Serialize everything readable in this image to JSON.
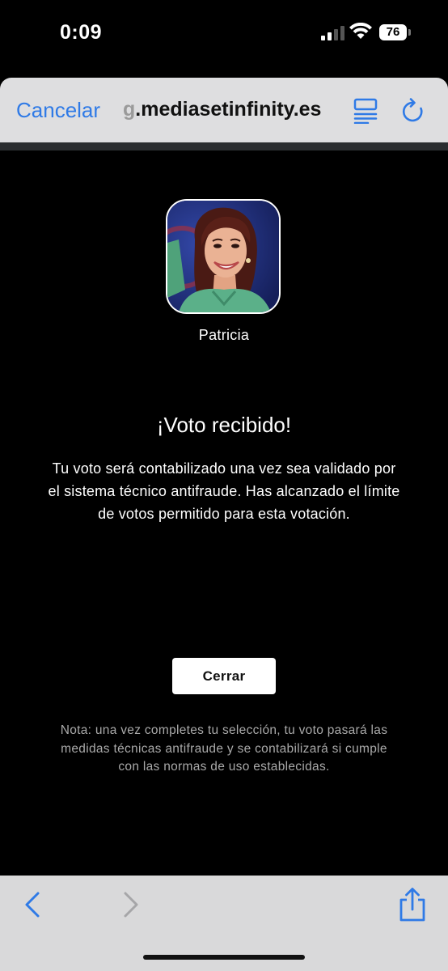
{
  "status_bar": {
    "time": "0:09",
    "battery": "76"
  },
  "header": {
    "cancel_label": "Cancelar",
    "url_prefix": "g",
    "url": ".mediasetinfinity.es"
  },
  "contestant": {
    "name": "Patricia"
  },
  "confirmation": {
    "title": "¡Voto recibido!",
    "message": "Tu voto será contabilizado una vez sea validado por el sistema técnico antifraude. Has alcanzado el límite de votos permitido para esta votación.",
    "close_label": "Cerrar",
    "note": "Nota: una vez completes tu selección, tu voto pasará las medidas técnicas antifraude y se contabilizará si cumple con las normas de uso establecidas."
  },
  "icons": {
    "signal": "cellular-signal-icon",
    "wifi": "wifi-icon",
    "reader": "reader-mode-icon",
    "reload": "reload-icon",
    "back": "back-chevron-icon",
    "forward": "forward-chevron-icon",
    "share": "share-icon"
  },
  "colors": {
    "accent": "#2f7ae6",
    "background": "#000000",
    "toolbar": "#d9d9da"
  }
}
